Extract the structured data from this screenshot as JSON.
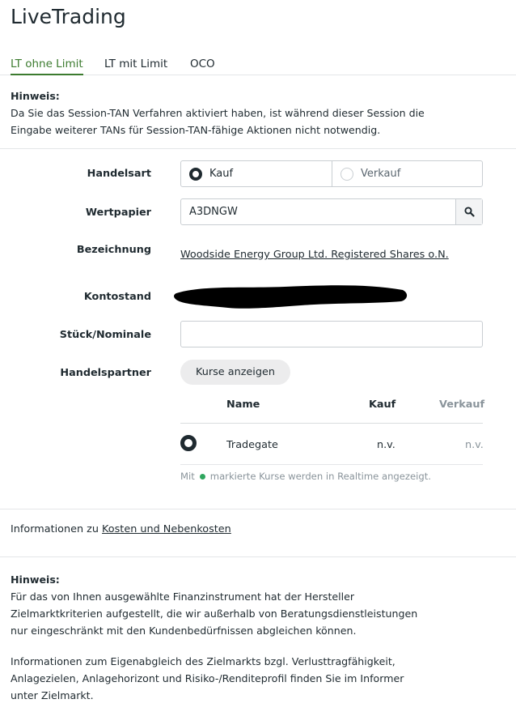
{
  "header": {
    "title": "LiveTrading"
  },
  "tabs": [
    {
      "label": "LT ohne Limit",
      "active": true
    },
    {
      "label": "LT mit Limit",
      "active": false
    },
    {
      "label": "OCO",
      "active": false
    }
  ],
  "session_notice": {
    "heading": "Hinweis:",
    "line1": "Da Sie das Session-TAN Verfahren aktiviert haben, ist während dieser Session die",
    "line2": "Eingabe weiterer TANs für Session-TAN-fähige Aktionen nicht notwendig."
  },
  "form": {
    "handelsart_label": "Handelsart",
    "handelsart_options": [
      {
        "label": "Kauf",
        "selected": true
      },
      {
        "label": "Verkauf",
        "selected": false
      }
    ],
    "wertpapier_label": "Wertpapier",
    "wertpapier_value": "A3DNGW",
    "bezeichnung_label": "Bezeichnung",
    "bezeichnung_value": "Woodside Energy Group Ltd. Registered Shares o.N.",
    "kontostand_label": "Kontostand",
    "stueck_label": "Stück/Nominale",
    "stueck_value": "",
    "handelspartner_label": "Handelspartner",
    "kurse_button": "Kurse anzeigen"
  },
  "partner_table": {
    "headers": {
      "name": "Name",
      "kauf": "Kauf",
      "verkauf": "Verkauf"
    },
    "rows": [
      {
        "name": "Tradegate",
        "kauf": "n.v.",
        "verkauf": "n.v.",
        "selected": true
      }
    ],
    "legend_prefix": "Mit",
    "legend_suffix": "markierte Kurse werden in Realtime angezeigt."
  },
  "costs_info": {
    "prefix": "Informationen zu",
    "link": "Kosten und Nebenkosten"
  },
  "target_notice": {
    "heading": "Hinweis:",
    "p1_line1": "Für das von Ihnen ausgewählte Finanzinstrument hat der Hersteller",
    "p1_line2": "Zielmarktkriterien aufgestellt, die wir außerhalb von Beratungsdienstleistungen",
    "p1_line3": "nur eingeschränkt mit den Kundenbedürfnissen abgleichen können.",
    "p2_line1": "Informationen zum Eigenabgleich des Zielmarkts bzgl. Verlusttragfähigkeit,",
    "p2_line2": "Anlagezielen, Anlagehorizont und Risiko-/Renditeprofil finden Sie im Informer",
    "p2_line3": "unter Zielmarkt."
  },
  "colors": {
    "accent_green": "#3c7b2f",
    "realtime_dot": "#2fa65e",
    "text": "#1f2a30"
  }
}
